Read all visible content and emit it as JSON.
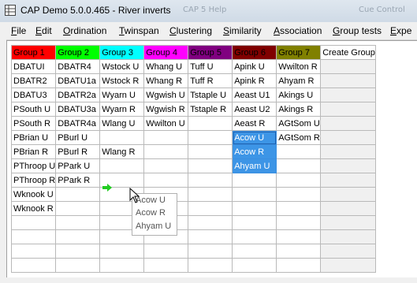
{
  "window": {
    "title": "CAP Demo 5.0.0.465 - River inverts",
    "ghost_left": "CAP 5 Help",
    "ghost_right": "Cue Control"
  },
  "menu": [
    {
      "label": "File",
      "accel": "F",
      "rest": "ile"
    },
    {
      "label": "Edit",
      "accel": "E",
      "rest": "dit"
    },
    {
      "label": "Ordination",
      "accel": "O",
      "rest": "rdination"
    },
    {
      "label": "Twinspan",
      "accel": "T",
      "rest": "winspan"
    },
    {
      "label": "Clustering",
      "accel": "C",
      "rest": "lustering"
    },
    {
      "label": "Similarity",
      "accel": "S",
      "rest": "imilarity"
    },
    {
      "label": "Association",
      "accel": "A",
      "rest": "ssociation"
    },
    {
      "label": "Group tests",
      "accel": "G",
      "rest": "roup tests"
    },
    {
      "label": "Expe",
      "accel": "E",
      "rest": "xpe"
    }
  ],
  "headers": [
    {
      "label": "Group 1",
      "bg": "#ff0000"
    },
    {
      "label": "Group 2",
      "bg": "#00ff00"
    },
    {
      "label": "Group 3",
      "bg": "#00ffff"
    },
    {
      "label": "Group 4",
      "bg": "#ff00ff"
    },
    {
      "label": "Group 5",
      "bg": "#800080"
    },
    {
      "label": "Group 6",
      "bg": "#800000"
    },
    {
      "label": "Group 7",
      "bg": "#808000"
    },
    {
      "label": "Create Group",
      "bg": "#ffffff"
    }
  ],
  "rows": [
    [
      "DBATUI",
      "DBATR4",
      "Wstock U",
      "Whang U",
      "Tuff U",
      "Apink U",
      "Wwilton R",
      ""
    ],
    [
      "DBATR2",
      "DBATU1a",
      "Wstock R",
      "Whang R",
      "Tuff R",
      "Apink R",
      "Ahyam R",
      ""
    ],
    [
      "DBATU3",
      "DBATR2a",
      "Wyarn U",
      "Wgwish U",
      "Tstaple U",
      "Aeast U1",
      "Akings U",
      ""
    ],
    [
      "PSouth U",
      "DBATU3a",
      "Wyarn R",
      "Wgwish R",
      "Tstaple R",
      "Aeast U2",
      "Akings R",
      ""
    ],
    [
      "PSouth R",
      "DBATR4a",
      "Wlang U",
      "Wwilton U",
      "",
      "Aeast R",
      "AGtSom U",
      ""
    ],
    [
      "PBrian U",
      "PBurl U",
      "",
      "",
      "",
      "Acow U",
      "AGtSom R",
      ""
    ],
    [
      "PBrian R",
      "PBurl R",
      "Wlang R",
      "",
      "",
      "Acow R",
      "",
      ""
    ],
    [
      "PThroop U",
      "PPark U",
      "",
      "",
      "",
      "Ahyam U",
      "",
      ""
    ],
    [
      "PThroop R",
      "PPark R",
      "",
      "",
      "",
      "",
      "",
      ""
    ],
    [
      "Wknook U",
      "",
      "",
      "",
      "",
      "",
      "",
      ""
    ],
    [
      "Wknook R",
      "",
      "",
      "",
      "",
      "",
      "",
      ""
    ],
    [
      "",
      "",
      "",
      "",
      "",
      "",
      "",
      ""
    ],
    [
      "",
      "",
      "",
      "",
      "",
      "",
      "",
      ""
    ],
    [
      "",
      "",
      "",
      "",
      "",
      "",
      "",
      ""
    ],
    [
      "",
      "",
      "",
      "",
      "",
      "",
      "",
      ""
    ]
  ],
  "selected_color": "#3d95e6",
  "drag_popup": [
    "Acow U",
    "Acow R",
    "Ahyam U"
  ]
}
